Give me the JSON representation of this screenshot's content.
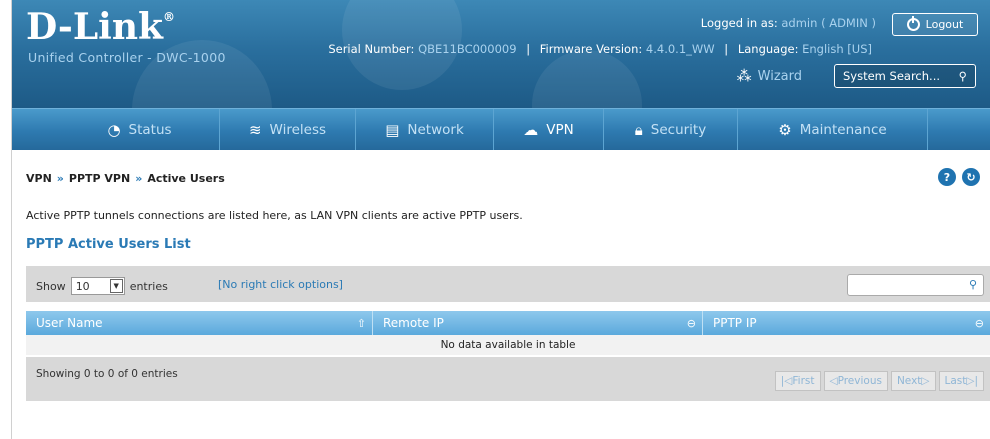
{
  "header": {
    "brand": "D-Link",
    "brand_mark": "®",
    "subtitle": "Unified Controller - DWC-1000",
    "logged_in_label": "Logged in as:",
    "logged_in_value": "admin ( ADMIN )",
    "logout_label": "Logout",
    "serial_label": "Serial Number:",
    "serial_value": "QBE11BC000009",
    "firmware_label": "Firmware Version:",
    "firmware_value": "4.4.0.1_WW",
    "language_label": "Language:",
    "language_value": "English [US]",
    "wizard_label": "Wizard",
    "search_placeholder": "System Search..."
  },
  "nav": {
    "items": [
      {
        "label": "Status",
        "icon": "dashboard-icon"
      },
      {
        "label": "Wireless",
        "icon": "wifi-icon"
      },
      {
        "label": "Network",
        "icon": "monitor-icon"
      },
      {
        "label": "VPN",
        "icon": "cloud-lock-icon",
        "active": true
      },
      {
        "label": "Security",
        "icon": "lock-icon"
      },
      {
        "label": "Maintenance",
        "icon": "gears-icon"
      }
    ]
  },
  "breadcrumb": {
    "items": [
      "VPN",
      "PPTP VPN",
      "Active Users"
    ],
    "separator": "»"
  },
  "page": {
    "description": "Active PPTP tunnels connections are listed here, as LAN VPN clients are active PPTP users.",
    "section_title": "PPTP Active Users List"
  },
  "table": {
    "show_label": "Show",
    "entries_value": "10",
    "entries_label": "entries",
    "no_right_click": "[No right click options]",
    "columns": [
      "User Name",
      "Remote IP",
      "PPTP IP"
    ],
    "empty_text": "No data available in table",
    "showing_text": "Showing 0 to 0 of 0 entries",
    "pager": {
      "first": "First",
      "previous": "Previous",
      "next": "Next",
      "last": "Last"
    }
  }
}
